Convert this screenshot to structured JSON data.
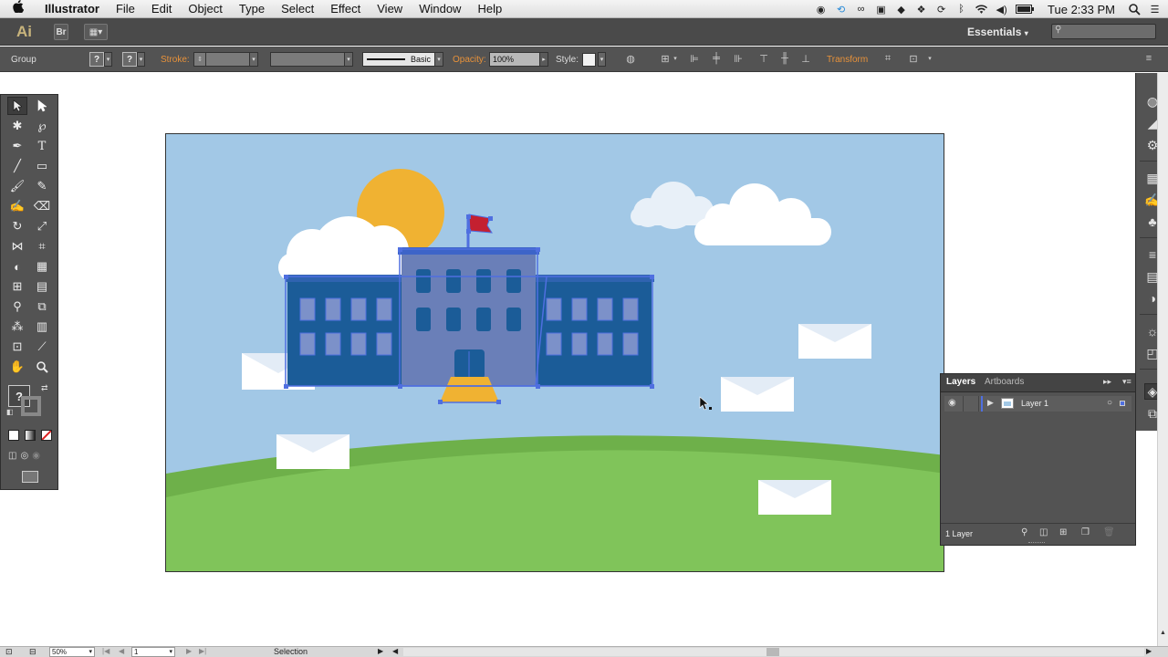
{
  "menubar": {
    "app_name": "Illustrator",
    "items": [
      "File",
      "Edit",
      "Object",
      "Type",
      "Select",
      "Effect",
      "View",
      "Window",
      "Help"
    ],
    "clock": "Tue 2:33 PM"
  },
  "appbar": {
    "logo": "Ai",
    "bridge": "Br",
    "workspace": "Essentials",
    "search_placeholder": ""
  },
  "control_bar": {
    "selection_type": "Group",
    "fill_swatch": "?",
    "stroke_swatch": "?",
    "stroke_label": "Stroke:",
    "brush_label": "Basic",
    "opacity_label": "Opacity:",
    "opacity_value": "100%",
    "style_label": "Style:",
    "transform_label": "Transform"
  },
  "tools_panel": {
    "unknown_color": "?"
  },
  "layers_panel": {
    "tabs": [
      "Layers",
      "Artboards"
    ],
    "layer_name": "Layer 1",
    "footer_count": "1 Layer"
  },
  "status_bar": {
    "zoom": "50%",
    "artboard_number": "1",
    "current_tool": "Selection"
  },
  "colors": {
    "sky": "#a2c8e6",
    "sun": "#f0b232",
    "grass": "#80c45a",
    "grass_dark": "#6eb04a",
    "building_dark": "#1b5c98",
    "building_selected": "#6a7fb8",
    "selection": "#4f6fe0",
    "flag": "#c42030",
    "steps": "#f0b232"
  }
}
